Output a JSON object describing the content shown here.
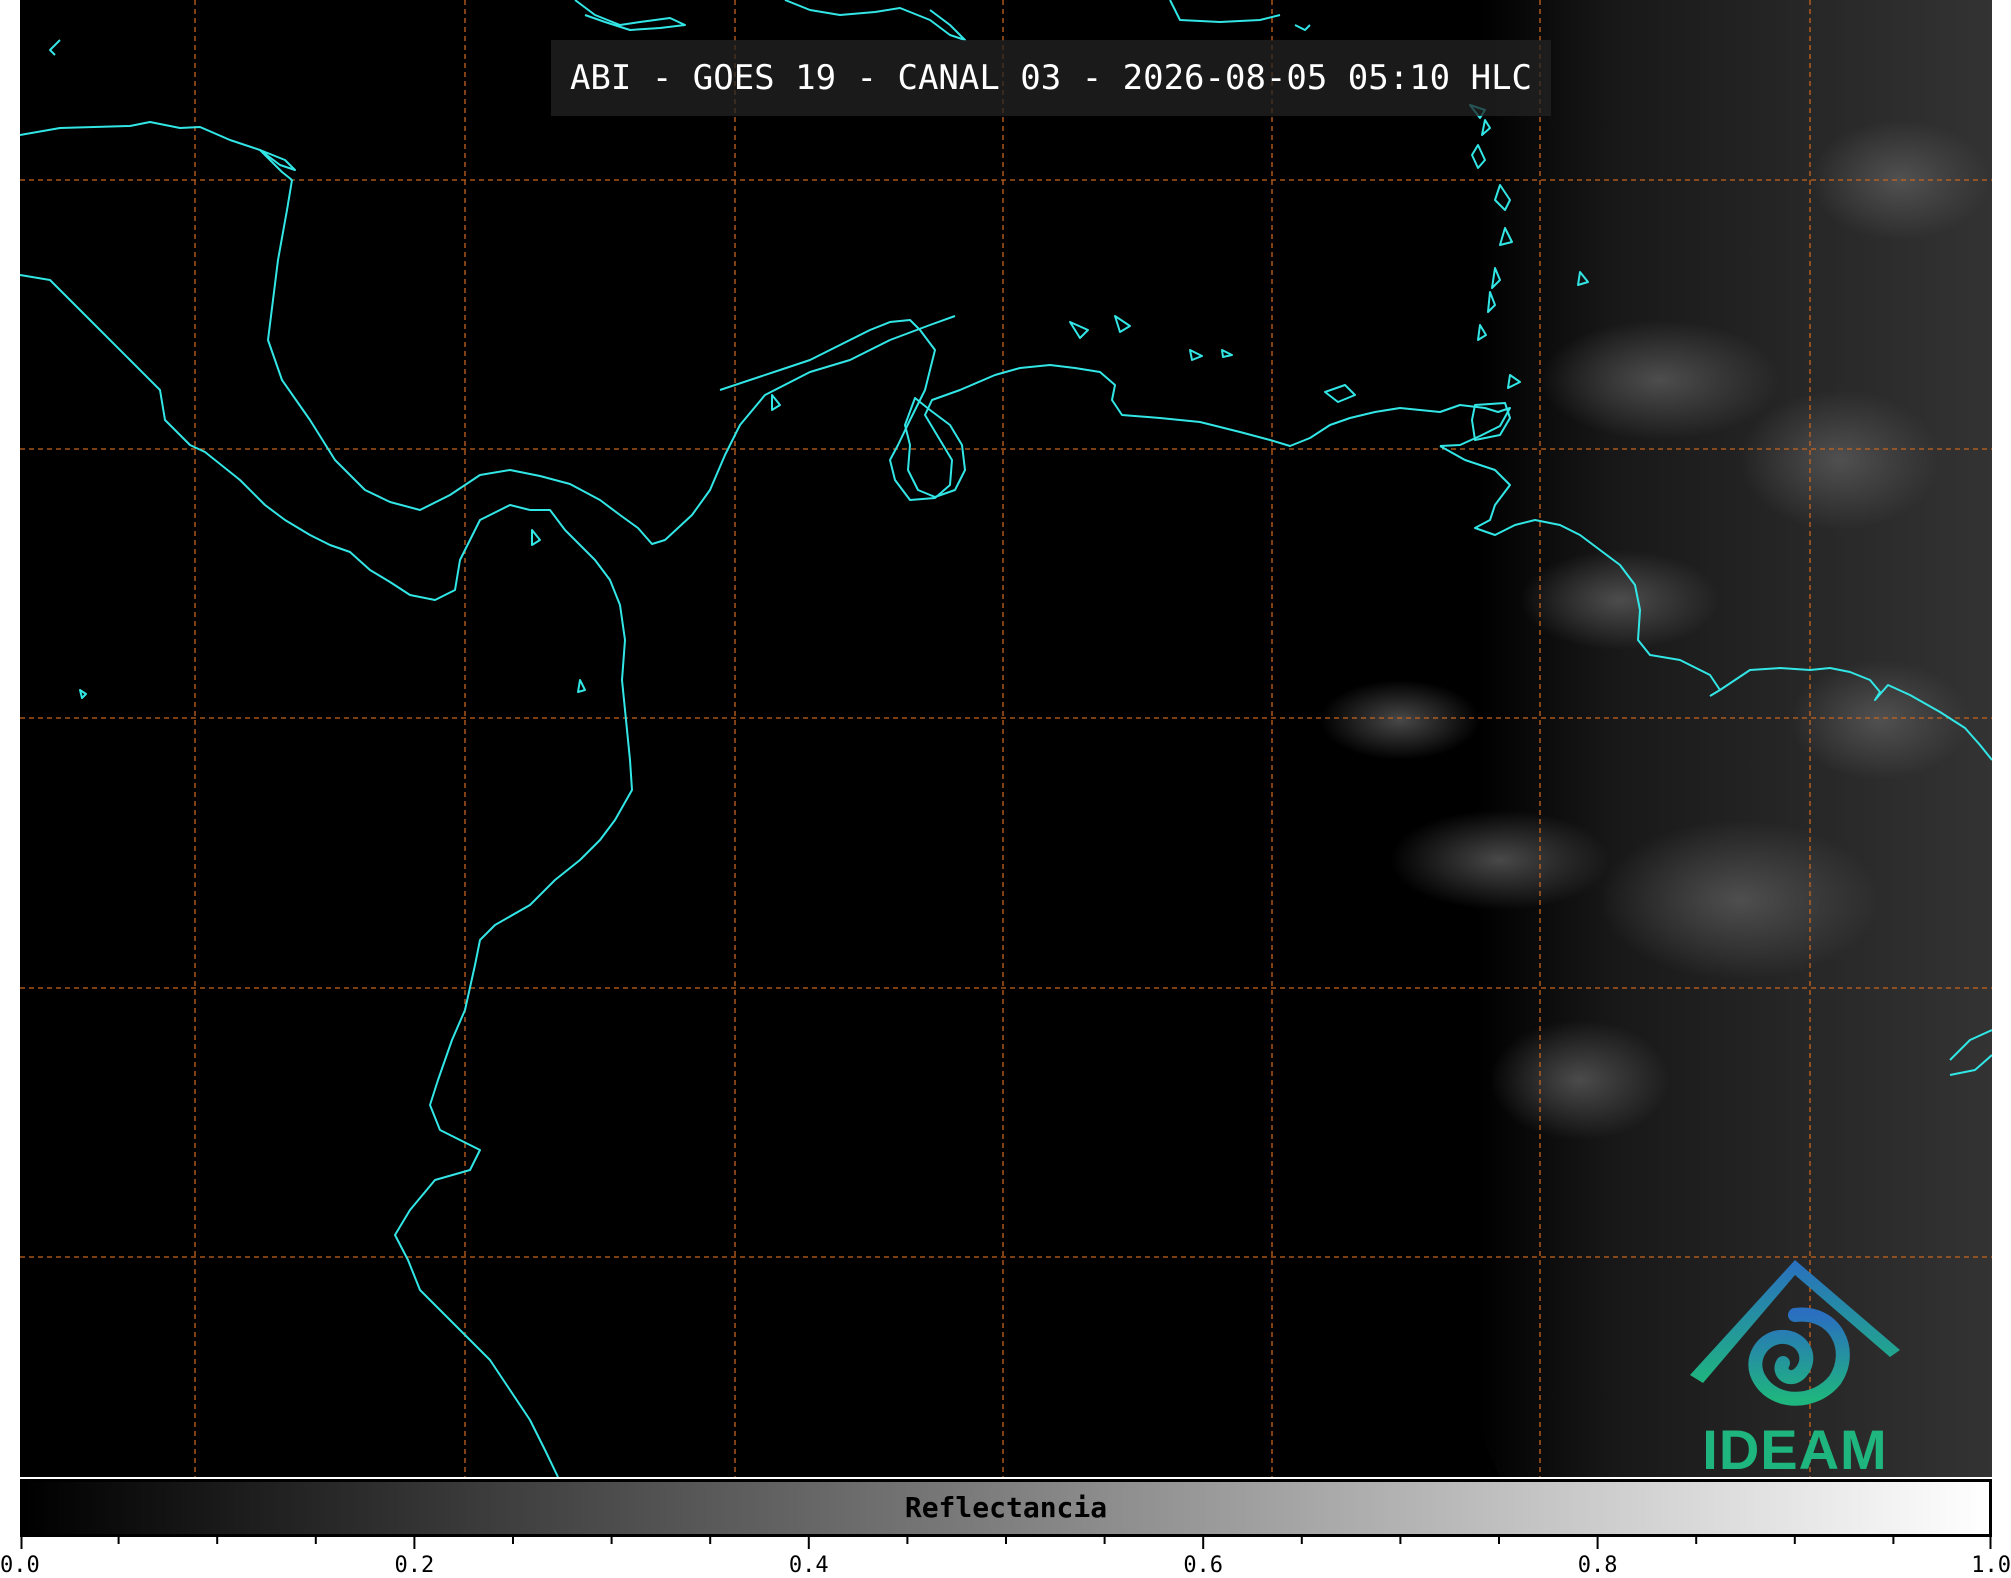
{
  "title": "ABI - GOES 19 - CANAL 03 - 2026-08-05 05:10 HLC",
  "colorbar": {
    "label": "Reflectancia",
    "min": 0.0,
    "max": 1.0,
    "tick_labels": [
      "0.0",
      "0.2",
      "0.4",
      "0.6",
      "0.8",
      "1.0"
    ],
    "minor_tick_step": 0.05,
    "gradient_from": "#000000",
    "gradient_to": "#ffffff"
  },
  "logo": {
    "text": "IDEAM",
    "icon": "ideam-logo-icon",
    "color": "#1fb57f"
  },
  "colors": {
    "coastline": "#33e6e6",
    "gridline": "#c8641e",
    "background": "#000000"
  }
}
